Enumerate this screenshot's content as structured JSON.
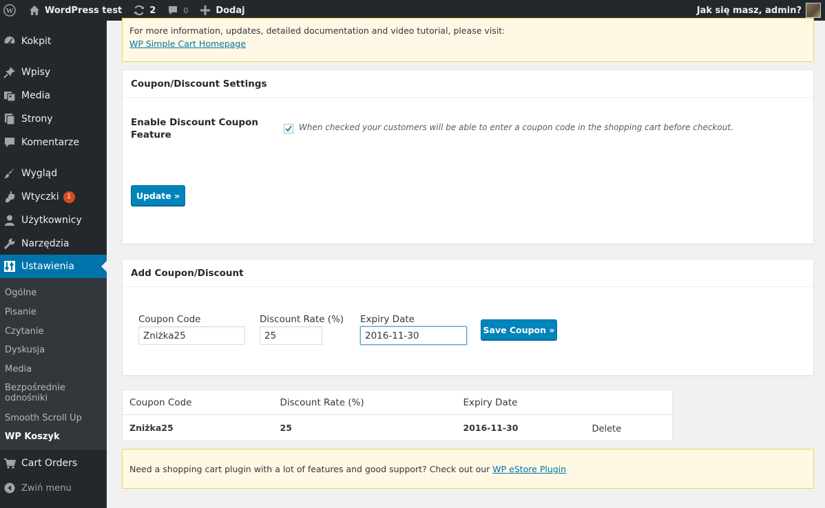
{
  "adminbar": {
    "site_name": "WordPress test",
    "updates_count": "2",
    "comments_count": "0",
    "new_label": "Dodaj",
    "greeting": "Jak się masz, admin?"
  },
  "sidebar": {
    "items": [
      {
        "label": "Kokpit",
        "icon": "dashboard-icon"
      },
      {
        "label": "Wpisy",
        "icon": "pin-icon"
      },
      {
        "label": "Media",
        "icon": "media-icon"
      },
      {
        "label": "Strony",
        "icon": "page-icon"
      },
      {
        "label": "Komentarze",
        "icon": "comment-icon"
      },
      {
        "label": "Wygląd",
        "icon": "brush-icon"
      },
      {
        "label": "Wtyczki",
        "icon": "plugin-icon",
        "badge": "1"
      },
      {
        "label": "Użytkownicy",
        "icon": "user-icon"
      },
      {
        "label": "Narzędzia",
        "icon": "wrench-icon"
      },
      {
        "label": "Ustawienia",
        "icon": "settings-icon"
      },
      {
        "label": "Cart Orders",
        "icon": "cart-icon"
      }
    ],
    "submenu": [
      "Ogólne",
      "Pisanie",
      "Czytanie",
      "Dyskusja",
      "Media",
      "Bezpośrednie odnośniki",
      "Smooth Scroll Up",
      "WP Koszyk"
    ],
    "collapse_label": "Zwiń menu"
  },
  "top_notice": {
    "text": "For more information, updates, detailed documentation and video tutorial, please visit:",
    "link": "WP Simple Cart Homepage"
  },
  "settings_box": {
    "title": "Coupon/Discount Settings",
    "label": "Enable Discount Coupon Feature",
    "checked": true,
    "description": "When checked your customers will be able to enter a coupon code in the shopping cart before checkout.",
    "button": "Update »"
  },
  "add_box": {
    "title": "Add Coupon/Discount",
    "code_label": "Coupon Code",
    "code_value": "Zniżka25",
    "rate_label": "Discount Rate (%)",
    "rate_value": "25",
    "expiry_label": "Expiry Date",
    "expiry_value": "2016-11-30",
    "button": "Save Coupon »"
  },
  "coupon_table": {
    "headers": [
      "Coupon Code",
      "Discount Rate (%)",
      "Expiry Date",
      ""
    ],
    "rows": [
      {
        "code": "Zniżka25",
        "rate": "25",
        "expiry": "2016-11-30",
        "action": "Delete"
      }
    ]
  },
  "bottom_notice": {
    "text": "Need a shopping cart plugin with a lot of features and good support? Check out our",
    "link": "WP eStore Plugin"
  },
  "colors": {
    "adminbar": "#23282d",
    "active": "#0073aa",
    "button": "#0085ba",
    "badge": "#d54e21",
    "notice_bg": "#fff8e5"
  }
}
